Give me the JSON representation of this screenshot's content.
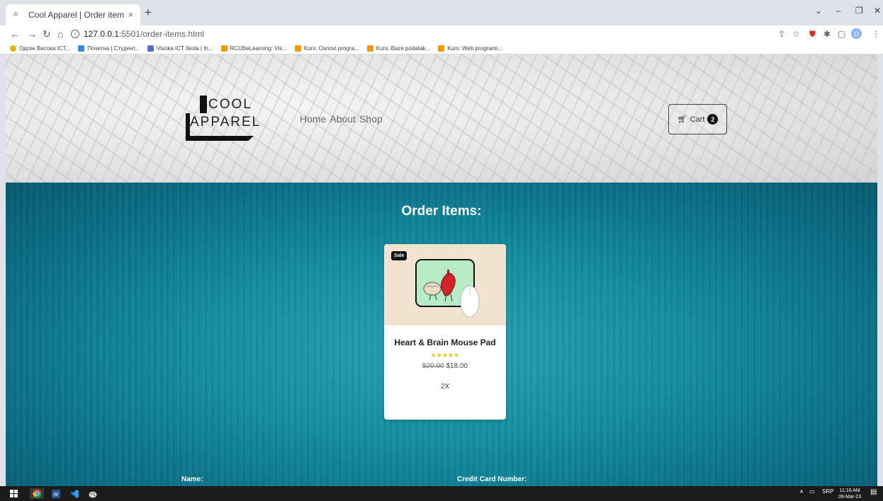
{
  "browser": {
    "tab_title": "Cool Apparel | Order items",
    "tab_close": "×",
    "new_tab": "+",
    "url_host": "127.0.0.1",
    "url_path": ":5501/order-items.html",
    "bookmarks": [
      {
        "label": "Одсек Висока ICT...",
        "color": "#e0b300"
      },
      {
        "label": "Почетна | Студент...",
        "color": "#3b8ad9"
      },
      {
        "label": "Visoka ICT škola | In...",
        "color": "#5b6acb"
      },
      {
        "label": "RCUBeLearning: Vis...",
        "color": "#f29a00"
      },
      {
        "label": "Kurs: Osnovi progra...",
        "color": "#f29a00"
      },
      {
        "label": "Kurs: Baze podatak...",
        "color": "#f29a00"
      },
      {
        "label": "Kurs: Web programi...",
        "color": "#f29a00"
      }
    ],
    "profile_initial": "D"
  },
  "header": {
    "logo_line1": "COOL",
    "logo_line2": "APPAREL",
    "nav": [
      {
        "label": "Home"
      },
      {
        "label": "About"
      },
      {
        "label": "Shop"
      }
    ],
    "cart_label": "Cart",
    "cart_count": "2"
  },
  "main": {
    "title": "Order Items:",
    "items": [
      {
        "badge": "Sale",
        "name": "Heart & Brain Mouse Pad",
        "old_price": "$20.00",
        "price": "$18.00",
        "quantity": "2X",
        "rating_stars": 5
      }
    ],
    "form_labels": {
      "name": "Name:",
      "card": "Credit Card Number:"
    }
  },
  "taskbar": {
    "lang": "SRP",
    "time": "11:16 AM",
    "date": "09-Mar-23"
  },
  "icons": {
    "back": "arrow-left-icon",
    "forward": "arrow-right-icon",
    "reload": "reload-icon",
    "home": "home-icon",
    "cart": "cart-icon"
  }
}
